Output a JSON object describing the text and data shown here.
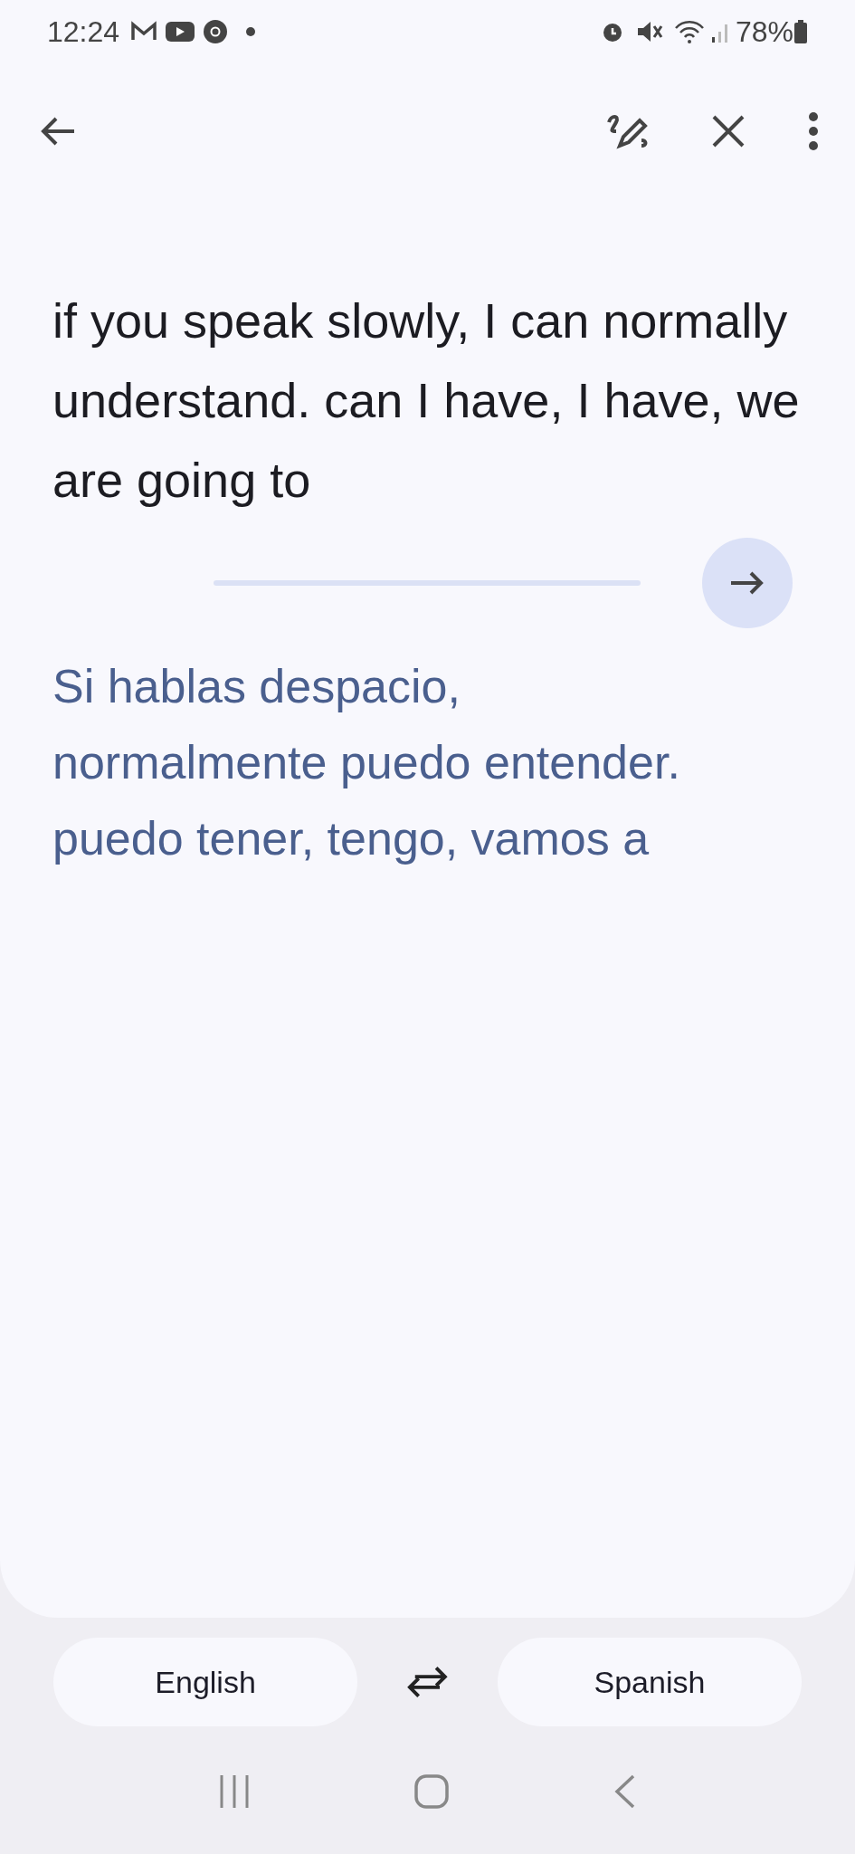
{
  "status_bar": {
    "time": "12:24",
    "battery": "78%"
  },
  "source_text": "if you speak slowly, I can normally understand. can I have, I have, we are going to",
  "translation": "Si hablas despacio, normalmente puedo entender.  puedo tener, tengo, vamos a",
  "languages": [
    {
      "label": "English"
    },
    {
      "label": "Spanish"
    }
  ]
}
